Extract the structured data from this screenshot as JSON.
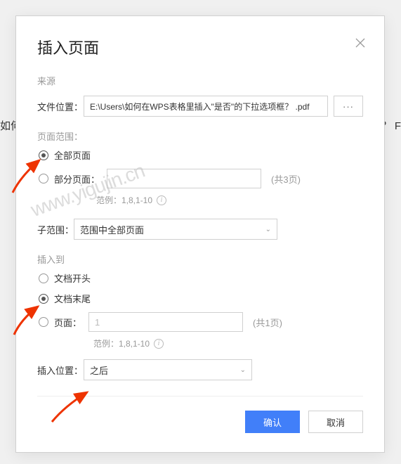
{
  "bg": {
    "left": "如何",
    "right": "？  F"
  },
  "dialog": {
    "title": "插入页面",
    "source": {
      "label": "来源",
      "fileLabel": "文件位置：",
      "filePath": "E:\\Users\\如何在WPS表格里插入\"是否\"的下拉选项框？ .pdf",
      "more": "···"
    },
    "pageRange": {
      "label": "页面范围：",
      "all": "全部页面",
      "partial": "部分页面：",
      "count": "(共3页)",
      "hint": "范例：1,8,1-10",
      "subRangeLabel": "子范围：",
      "subRangeValue": "范围中全部页面"
    },
    "insertTo": {
      "label": "插入到",
      "docStart": "文档开头",
      "docEnd": "文档末尾",
      "page": "页面：",
      "pageValue": "1",
      "count": "(共1页)",
      "hint": "范例：1,8,1-10",
      "posLabel": "插入位置：",
      "posValue": "之后"
    },
    "actions": {
      "ok": "确认",
      "cancel": "取消"
    }
  },
  "watermark": "www.yigujin.cn"
}
